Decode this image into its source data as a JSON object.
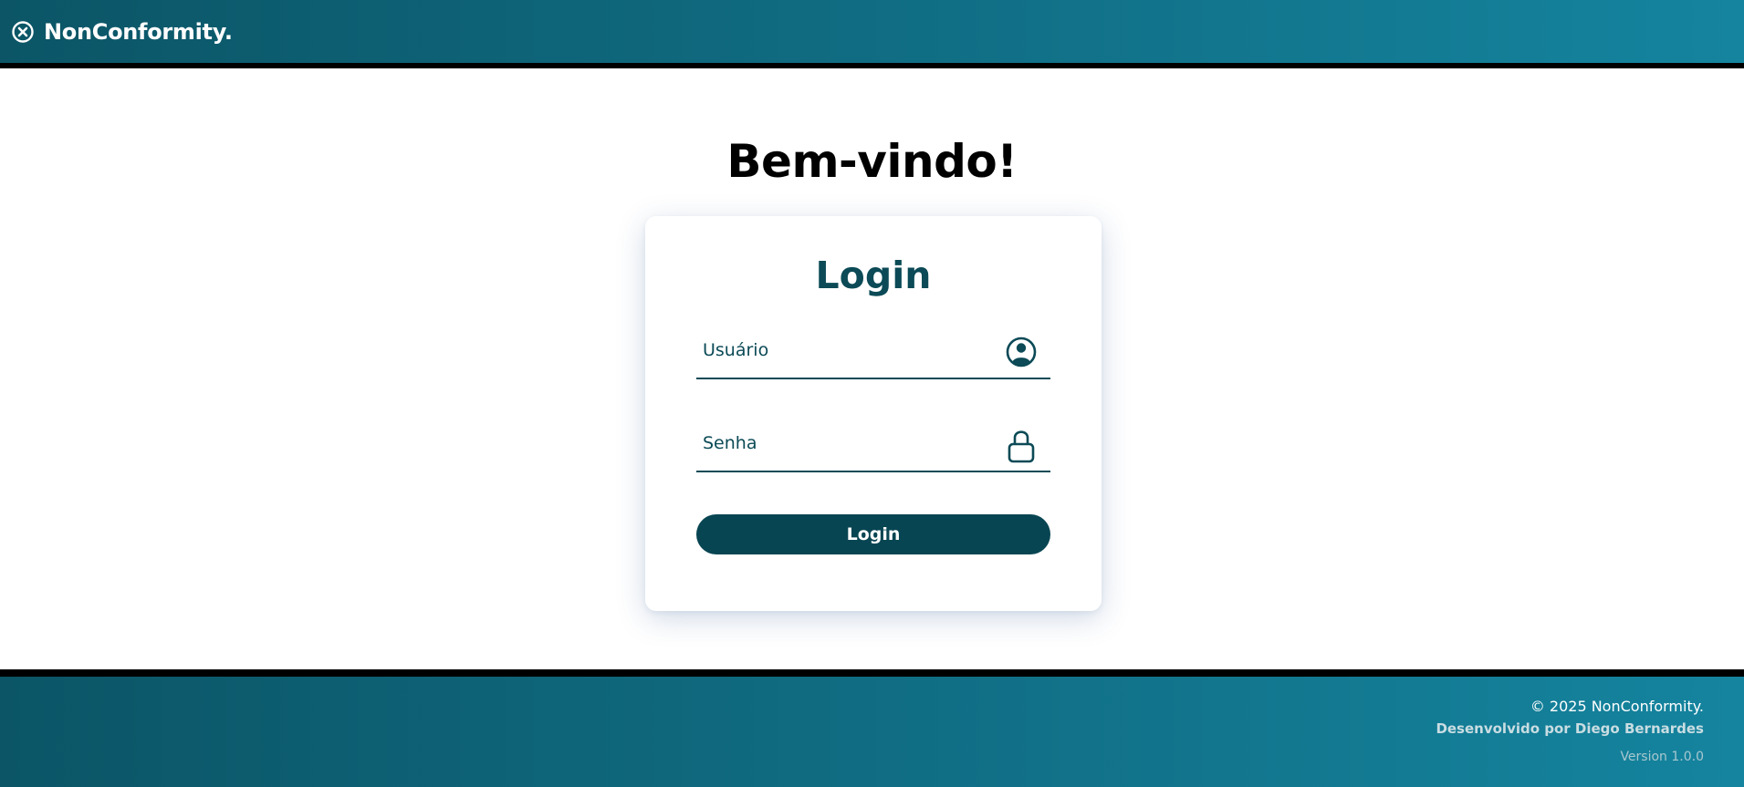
{
  "header": {
    "brand_icon": "close-circle-icon",
    "brand_name": "NonConformity."
  },
  "main": {
    "welcome": "Bem-vindo!",
    "login_card": {
      "title": "Login",
      "username": {
        "placeholder": "Usuário",
        "value": "",
        "icon": "user-circle-icon"
      },
      "password": {
        "placeholder": "Senha",
        "value": "",
        "icon": "lock-icon"
      },
      "submit_label": "Login"
    }
  },
  "footer": {
    "copyright": "© 2025 NonConformity.",
    "developer": "Desenvolvido por Diego Bernardes",
    "version": "Version 1.0.0"
  },
  "colors": {
    "header_gradient_start": "#0b5566",
    "header_gradient_end": "#15849f",
    "primary": "#0b4a56",
    "button": "#084552"
  }
}
